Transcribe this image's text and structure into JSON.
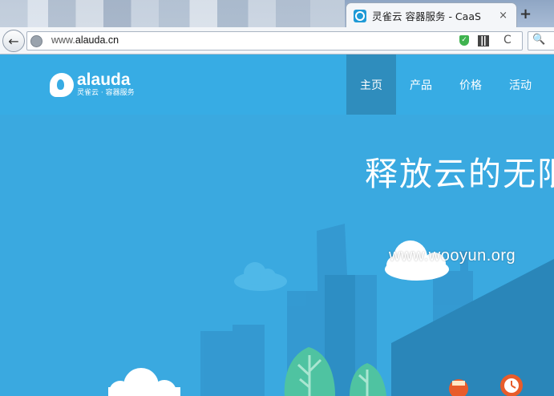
{
  "browser": {
    "tab_title": "灵雀云 容器服务 - CaaS",
    "tab_close": "×",
    "new_tab": "+",
    "back": "←",
    "url_prefix": "www.",
    "url_domain": "alauda.cn",
    "reload": "C",
    "search_glyph": "🔍"
  },
  "site": {
    "logo_word": "alauda",
    "logo_sub": "灵雀云 · 容器服务",
    "nav": [
      {
        "label": "主页",
        "active": true
      },
      {
        "label": "产品",
        "active": false
      },
      {
        "label": "价格",
        "active": false
      },
      {
        "label": "活动",
        "active": false
      }
    ],
    "hero_title": "释放云的无限"
  },
  "watermark": "www.wooyun.org",
  "colors": {
    "header": "#37ace4",
    "nav_active": "#2f8dbd",
    "hero": "#3aa9e0",
    "buildings": "#2c8fc2"
  }
}
